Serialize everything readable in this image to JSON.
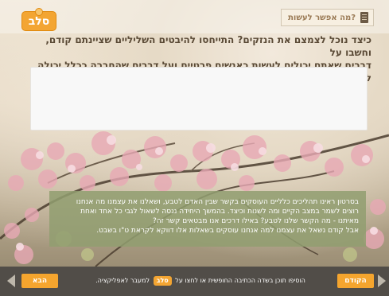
{
  "brand": {
    "logo_text": "סלב"
  },
  "section": {
    "title": "מה אפשר לעשות?",
    "icon": "book-icon"
  },
  "question": {
    "line1": "כיצד נוכל לצמצם את הנזקים? התייחסו להיבטים השליליים שציינתם קודם, וחשבו על",
    "line2": "דברים שאתם יכולים לעשות כאנשים פרטיים ועל דברים שהחברה ככלל יכולה לעשות."
  },
  "answer": {
    "value": "",
    "placeholder": ""
  },
  "info": {
    "line1": "בסרטון ראינו תהליכים כלליים העוסקים בקשר שבין האדם לטבע, ושאלנו את עצמנו מה אנחנו",
    "line2": "רוצים לשמר במצב הקיים ומה לשנות וכיצד. בהמשך היחידה ננסה לשאול לגבי כל אחד ואחת",
    "line3": "מאיתנו - מה הקשר שלנו לטבע? באילו דרכים אנו מבטאים קשר זה?",
    "line4": "אבל קודם נשאל את עצמנו למה אנחנו עוסקים בשאלות אלו דווקא לקראת ט\"ו בשבט."
  },
  "footer": {
    "next_label": "הבא",
    "prev_label": "הקודם",
    "hint_before": "הוסיפו תוכן בשדה הכתיבה החופשית או לחצו על",
    "hint_logo": "סלב",
    "hint_after": "למעבר לאפליקציה."
  },
  "colors": {
    "accent_orange": "#f5a52e",
    "title_brown": "#5a4a36",
    "info_green": "#909d70",
    "footer_bar": "#514d48"
  }
}
